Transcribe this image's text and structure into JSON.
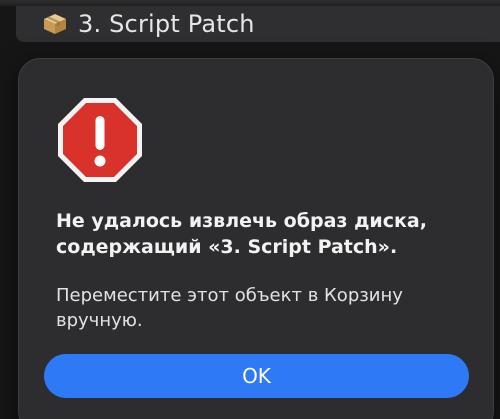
{
  "window": {
    "file_name": "3. Script Patch",
    "file_icon": "package-icon"
  },
  "alert": {
    "icon": "stop-sign-icon",
    "icon_symbol": "!",
    "title": "Не удалось извлечь образ диска,\nсодержащий «3. Script Patch».",
    "message": "Переместите этот объект в Корзину\nвручную.",
    "ok_label": "OK"
  },
  "colors": {
    "accent": "#2e79f6",
    "alert_red": "#d9322b",
    "dialog_bg": "#2d2d2f"
  }
}
